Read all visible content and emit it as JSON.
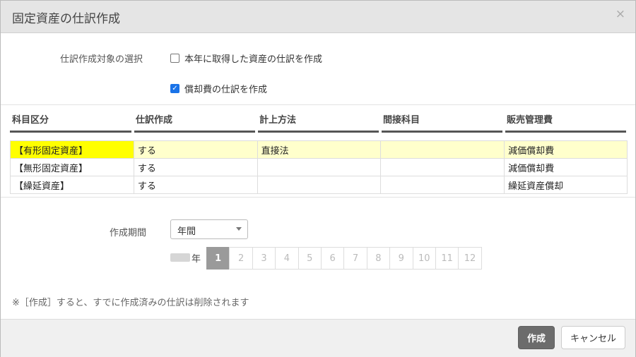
{
  "dialog": {
    "title": "固定資産の仕訳作成",
    "close_glyph": "×"
  },
  "target": {
    "label": "仕訳作成対象の選択",
    "options": [
      {
        "label": "本年に取得した資産の仕訳を作成",
        "checked": false
      },
      {
        "label": "償却費の仕訳を作成",
        "checked": true
      }
    ]
  },
  "table": {
    "headers": [
      "科目区分",
      "仕訳作成",
      "計上方法",
      "間接科目",
      "販売管理費"
    ],
    "rows": [
      [
        "【有形固定資産】",
        "する",
        "直接法",
        "",
        "減価償却費"
      ],
      [
        "【無形固定資産】",
        "する",
        "",
        "",
        "減価償却費"
      ],
      [
        "【繰延資産】",
        "する",
        "",
        "",
        "繰延資産償却"
      ]
    ]
  },
  "period": {
    "label": "作成期間",
    "selected": "年間",
    "year_suffix": "年",
    "months": [
      "1",
      "2",
      "3",
      "4",
      "5",
      "6",
      "7",
      "8",
      "9",
      "10",
      "11",
      "12"
    ],
    "active_month": "1"
  },
  "note": "※［作成］すると、すでに作成済みの仕訳は削除されます",
  "footer": {
    "create_label": "作成",
    "cancel_label": "キャンセル"
  },
  "colors": {
    "highlight": "#ffff00",
    "selected_row": "#ffffcc",
    "primary_button": "#6c6c6c",
    "checkbox_checked": "#1a73e8"
  }
}
